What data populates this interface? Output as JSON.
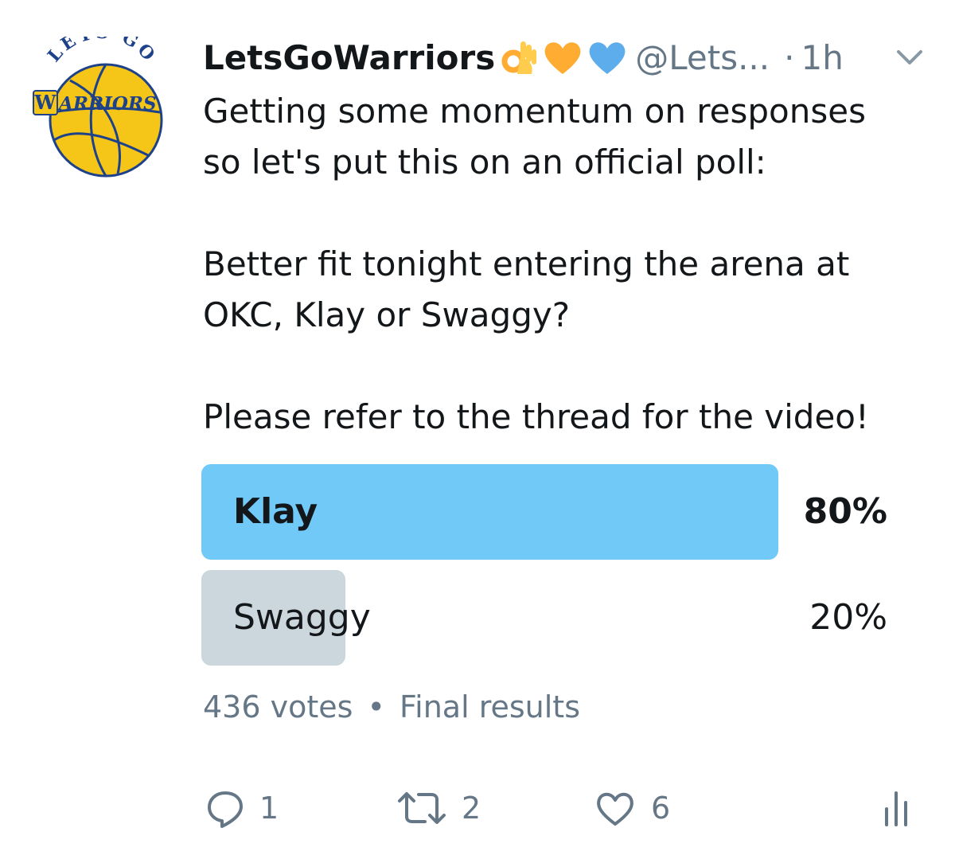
{
  "tweet": {
    "author": {
      "display_name": "LetsGoWarriors",
      "handle": "@Lets...",
      "time_separator": "·",
      "time": "1h",
      "emojis": [
        "ok-hand-emoji",
        "yellow-heart-emoji",
        "blue-heart-emoji"
      ],
      "avatar": {
        "top_text": "LETS GO",
        "main_text": "ARRIORS",
        "letter": "W"
      }
    },
    "text_lines": [
      "Getting some momentum on responses",
      "so let's put this on an official poll:",
      "",
      "Better fit tonight entering the arena at",
      "OKC, Klay or Swaggy?",
      "",
      "Please refer to the thread for the video!"
    ]
  },
  "poll": {
    "options": [
      {
        "label": "Klay",
        "percent_text": "80%",
        "share": 0.8,
        "winner": true
      },
      {
        "label": "Swaggy",
        "percent_text": "20%",
        "share": 0.2,
        "winner": false
      }
    ],
    "votes": "436 votes",
    "separator": "•",
    "status": "Final results"
  },
  "actions": {
    "reply_count": "1",
    "retweet_count": "2",
    "like_count": "6"
  },
  "colors": {
    "winner_bar": "#71c9f8",
    "loser_bar": "#ccd6dd",
    "secondary_text": "#657786",
    "primary_text": "#14171a",
    "avatar_yellow": "#f5c518",
    "avatar_blue": "#1d428a"
  }
}
